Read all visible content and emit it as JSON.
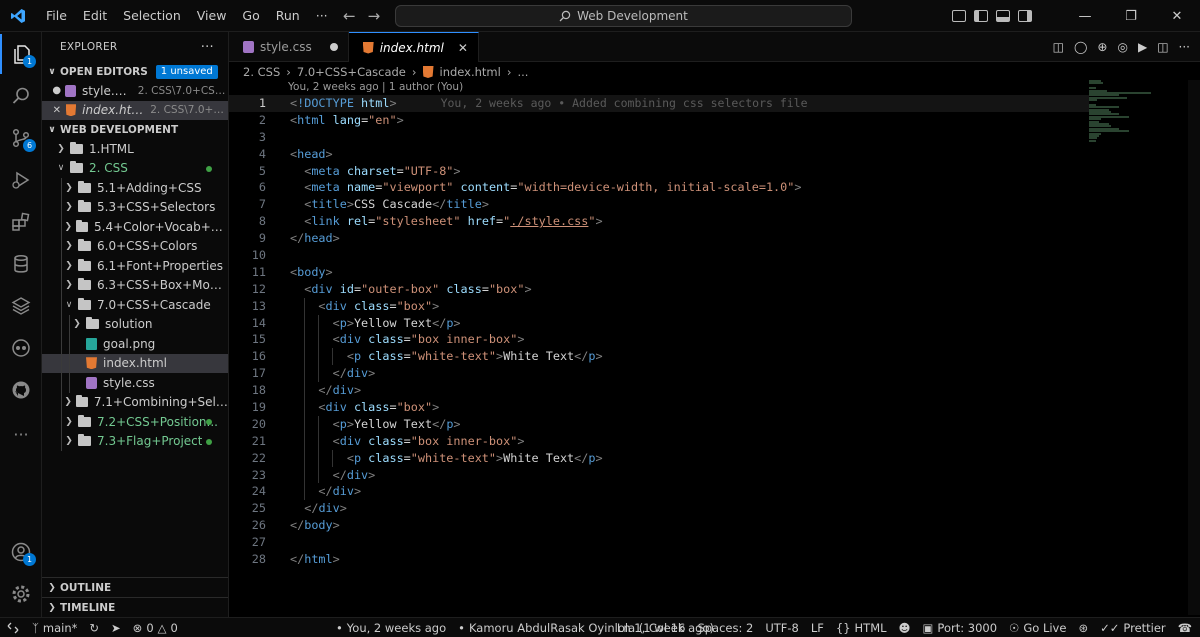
{
  "menu": [
    "File",
    "Edit",
    "Selection",
    "View",
    "Go",
    "Run",
    "···"
  ],
  "command_center": {
    "text": "Web Development"
  },
  "explorer": {
    "title": "EXPLORER",
    "more": "···",
    "open_editors": {
      "label": "OPEN EDITORS",
      "badge": "1 unsaved",
      "items": [
        {
          "name": "style.css",
          "path": "2. CSS\\7.0+CSS..."
        },
        {
          "name": "index.html",
          "path": "2. CSS\\7.0+C..."
        }
      ]
    },
    "workspace": {
      "label": "WEB DEVELOPMENT",
      "tree": [
        {
          "label": "1.HTML"
        },
        {
          "label": "2. CSS"
        },
        {
          "label": "5.1+Adding+CSS"
        },
        {
          "label": "5.3+CSS+Selectors"
        },
        {
          "label": "5.4+Color+Vocab+Proj..."
        },
        {
          "label": "6.0+CSS+Colors"
        },
        {
          "label": "6.1+Font+Properties"
        },
        {
          "label": "6.3+CSS+Box+Model"
        },
        {
          "label": "7.0+CSS+Cascade"
        },
        {
          "label": "solution"
        },
        {
          "label": "goal.png"
        },
        {
          "label": "index.html"
        },
        {
          "label": "style.css"
        },
        {
          "label": "7.1+Combining+Select..."
        },
        {
          "label": "7.2+CSS+Position..."
        },
        {
          "label": "7.3+Flag+Project"
        }
      ]
    },
    "outline": "OUTLINE",
    "timeline": "TIMELINE"
  },
  "activity_badges": {
    "explorer": "1",
    "source_control": "6",
    "accounts": "1"
  },
  "tabs": [
    {
      "label": "style.css"
    },
    {
      "label": "index.html"
    }
  ],
  "breadcrumbs": [
    "2. CSS",
    "7.0+CSS+Cascade",
    "index.html",
    "..."
  ],
  "codelens": "You, 2 weeks ago | 1 author (You)",
  "blame": "You, 2 weeks ago • Added combining css selectors file",
  "code_lines": [
    "1",
    "2",
    "3",
    "4",
    "5",
    "6",
    "7",
    "8",
    "9",
    "10",
    "11",
    "12",
    "13",
    "14",
    "15",
    "16",
    "17",
    "18",
    "19",
    "20",
    "21",
    "22",
    "23",
    "24",
    "25",
    "26",
    "27",
    "28"
  ],
  "code": {
    "doctype": "!DOCTYPE",
    "html": "html",
    "lang": "lang",
    "en": "\"en\"",
    "head": "head",
    "meta": "meta",
    "charset": "charset",
    "utf8": "\"UTF-8\"",
    "name": "name",
    "viewport": "\"viewport\"",
    "content": "content",
    "content_val": "\"width=device-width, initial-scale=1.0\"",
    "title": "title",
    "title_text": "CSS Cascade",
    "link": "link",
    "rel": "rel",
    "stylesheet": "\"stylesheet\"",
    "href": "href",
    "href_val": "./style.css",
    "body": "body",
    "div": "div",
    "id": "id",
    "outer_box": "\"outer-box\"",
    "class": "class",
    "box": "\"box\"",
    "p": "p",
    "yellow": "Yellow Text",
    "box_inner": "\"box inner-box\"",
    "white_text_cls": "\"white-text\"",
    "white": "White Text"
  },
  "status": {
    "branch": "main*",
    "errors": "0",
    "warnings": "0",
    "blame": "You, 2 weeks ago",
    "author": "Kamoru AbdulRasak Oyinlola (1 week ago)",
    "position": "Ln 1, Col 16",
    "spaces": "Spaces: 2",
    "encoding": "UTF-8",
    "eol": "LF",
    "language": "HTML",
    "port": "Port: 3000",
    "golive": "Go Live",
    "prettier": "Prettier"
  },
  "colors": {
    "accent": "#0078d4",
    "tag": "#569cd6",
    "attr": "#9cdcfe",
    "string": "#ce9178",
    "git_added": "#73c991"
  }
}
